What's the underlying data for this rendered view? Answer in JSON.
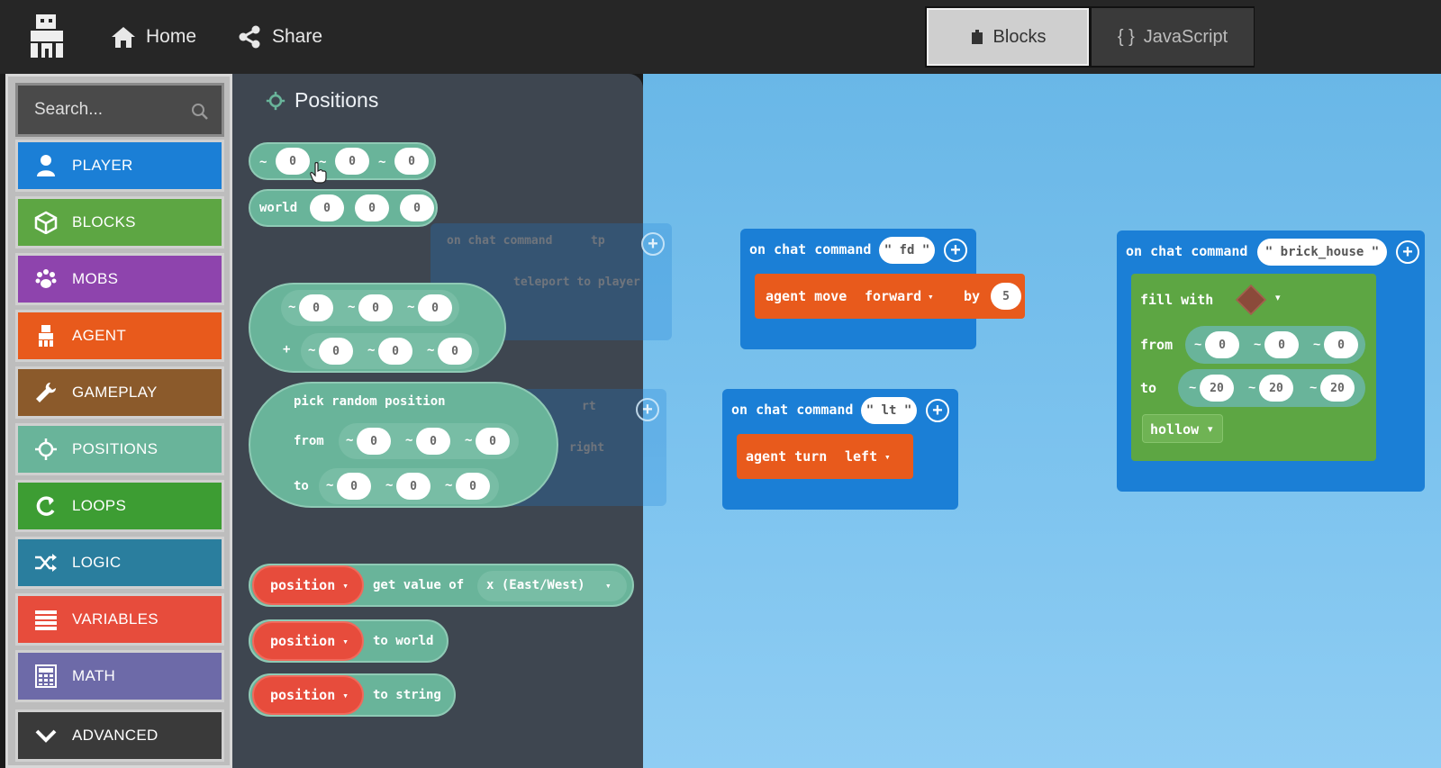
{
  "header": {
    "nav": [
      {
        "label": "Home",
        "icon": "home-icon"
      },
      {
        "label": "Share",
        "icon": "share-icon"
      }
    ],
    "modes": [
      {
        "label": "Blocks",
        "icon": "puzzle-icon",
        "active": true
      },
      {
        "label": "JavaScript",
        "icon": "braces-icon",
        "active": false
      }
    ],
    "braces": "{ }"
  },
  "toolbox": {
    "search_placeholder": "Search...",
    "categories": [
      {
        "label": "PLAYER",
        "color": "#1b7fd6",
        "icon": "person-icon"
      },
      {
        "label": "BLOCKS",
        "color": "#5da643",
        "icon": "cube-icon"
      },
      {
        "label": "MOBS",
        "color": "#8e44ad",
        "icon": "paw-icon"
      },
      {
        "label": "AGENT",
        "color": "#e85a1c",
        "icon": "agent-icon"
      },
      {
        "label": "GAMEPLAY",
        "color": "#8b5a2b",
        "icon": "wrench-icon"
      },
      {
        "label": "POSITIONS",
        "color": "#69b49a",
        "icon": "crosshair-icon"
      },
      {
        "label": "LOOPS",
        "color": "#3d9d33",
        "icon": "loop-icon"
      },
      {
        "label": "LOGIC",
        "color": "#2a7e9e",
        "icon": "shuffle-icon"
      },
      {
        "label": "VARIABLES",
        "color": "#e74c3c",
        "icon": "list-icon"
      },
      {
        "label": "MATH",
        "color": "#6d6aa8",
        "icon": "calculator-icon"
      },
      {
        "label": "ADVANCED",
        "color": "#3a3a3a",
        "icon": "chevron-down-icon"
      }
    ]
  },
  "flyout": {
    "title": "Positions",
    "tilde": "~",
    "plus_sign": "+",
    "zero": "0",
    "world_label": "world",
    "pick_random": "pick random position",
    "from_label": "from",
    "to_label": "to",
    "position_label": "position",
    "dropdown_arrow": "▾",
    "get_value_of": "get value of",
    "axis_option": "x (East/West)",
    "to_world": "to world",
    "to_string": "to string",
    "ghost_cmd": "on chat command",
    "ghost_tp": "tp",
    "ghost_teleport": "teleport to player",
    "ghost_rt": "rt",
    "ghost_right": "right"
  },
  "workspace": {
    "on_chat_command": "on chat command",
    "block_fd": {
      "command": "\" fd \"",
      "action": "agent move",
      "direction": "forward",
      "by_label": "by",
      "amount": "5"
    },
    "block_lt": {
      "command": "\" lt \"",
      "action": "agent turn",
      "direction": "left"
    },
    "block_house": {
      "command": "\" brick_house \"",
      "fill_with": "fill with",
      "from_label": "from",
      "to_label": "to",
      "from": [
        "0",
        "0",
        "0"
      ],
      "to": [
        "20",
        "20",
        "20"
      ],
      "mode": "hollow"
    }
  }
}
